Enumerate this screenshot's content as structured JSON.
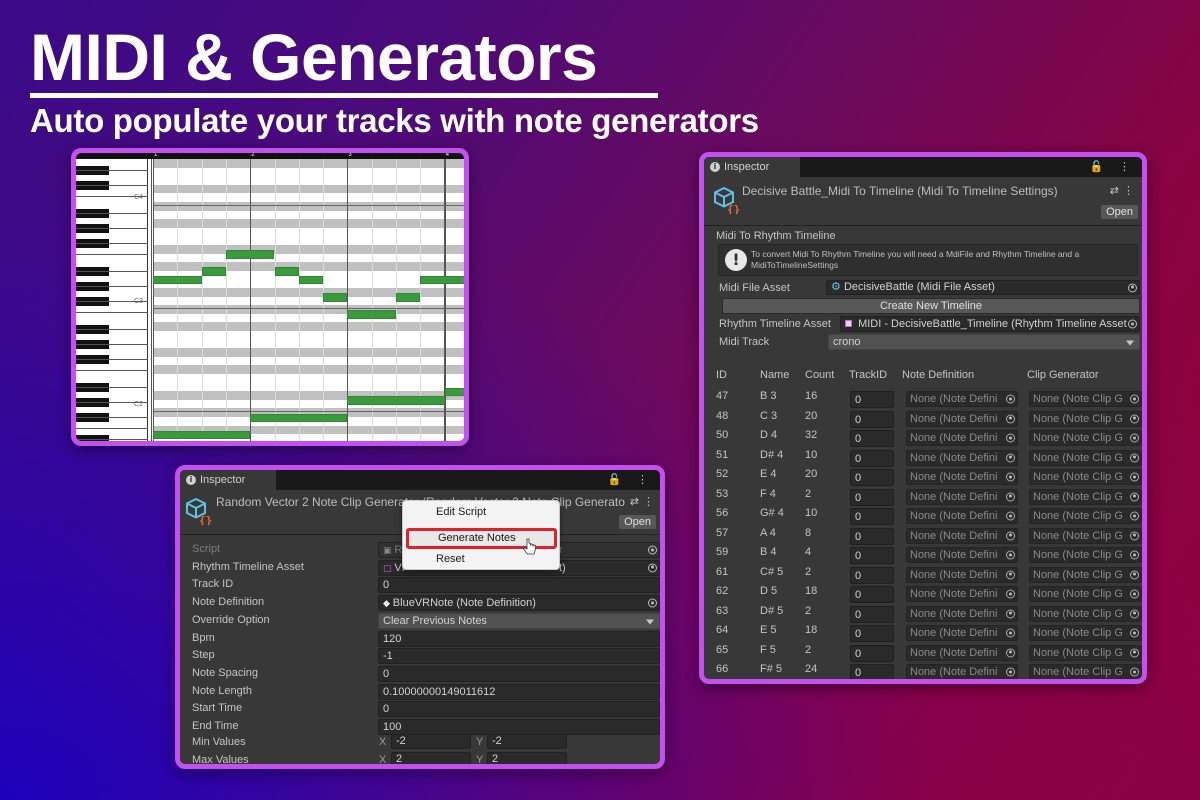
{
  "banner": {
    "title": "MIDI & Generators",
    "subtitle": "Auto populate your tracks with note generators"
  },
  "colors": {
    "panel_border": "#c550f0",
    "note_green": "#3a9a3c",
    "highlight_red": "#e0202a",
    "unity_bg": "#383838"
  },
  "piano_roll": {
    "bar_numbers": [
      "1",
      "2",
      "3",
      "4"
    ],
    "octave_labels": [
      "C4",
      "C3",
      "C2"
    ],
    "notes": [
      {
        "pitch_row": 14,
        "start_step": 0,
        "length_steps": 2
      },
      {
        "pitch_row": 13,
        "start_step": 2,
        "length_steps": 1
      },
      {
        "pitch_row": 11,
        "start_step": 3,
        "length_steps": 2
      },
      {
        "pitch_row": 13,
        "start_step": 5,
        "length_steps": 1
      },
      {
        "pitch_row": 14,
        "start_step": 6,
        "length_steps": 1
      },
      {
        "pitch_row": 16,
        "start_step": 7,
        "length_steps": 1
      },
      {
        "pitch_row": 18,
        "start_step": 8,
        "length_steps": 2
      },
      {
        "pitch_row": 16,
        "start_step": 10,
        "length_steps": 1
      },
      {
        "pitch_row": 14,
        "start_step": 11,
        "length_steps": 2
      },
      {
        "pitch_row": 27,
        "start_step": 12,
        "length_steps": 1
      },
      {
        "pitch_row": 28,
        "start_step": 8,
        "length_steps": 4
      },
      {
        "pitch_row": 30,
        "start_step": 4,
        "length_steps": 4
      },
      {
        "pitch_row": 32,
        "start_step": 0,
        "length_steps": 4
      }
    ]
  },
  "inspector_midi": {
    "tab_label": "Inspector",
    "tab_icons": "🔓 ⋮",
    "header_title": "Decisive Battle_Midi To Timeline (Midi To Timeline Settings)",
    "open_label": "Open",
    "section_label": "Midi To Rhythm Timeline",
    "help_text": "To convert Midi To Rhythm Timeline you will need a MdiFile and Rhythm Timeline and a MidiToTimelineSettings",
    "fields": {
      "midi_file_label": "Midi File Asset",
      "midi_file_value": "DecisiveBattle (Midi File Asset)",
      "create_button": "Create New Timeline",
      "rhythm_label": "Rhythm Timeline Asset",
      "rhythm_value": "MIDI - DecisiveBattle_Timeline (Rhythm Timeline Asset",
      "track_label": "Midi Track",
      "track_value": "crono"
    },
    "table": {
      "headers": [
        "ID",
        "Name",
        "Count",
        "TrackID",
        "Note Definition",
        "Clip Generator"
      ],
      "rows": [
        {
          "id": "47",
          "name": "B 3",
          "count": "16",
          "track_id": "0",
          "note_def": "None (Note Defini",
          "clip_gen": "None (Note Clip G"
        },
        {
          "id": "48",
          "name": "C 3",
          "count": "20",
          "track_id": "0",
          "note_def": "None (Note Defini",
          "clip_gen": "None (Note Clip G"
        },
        {
          "id": "50",
          "name": "D 4",
          "count": "32",
          "track_id": "0",
          "note_def": "None (Note Defini",
          "clip_gen": "None (Note Clip G"
        },
        {
          "id": "51",
          "name": "D# 4",
          "count": "10",
          "track_id": "0",
          "note_def": "None (Note Defini",
          "clip_gen": "None (Note Clip G"
        },
        {
          "id": "52",
          "name": "E 4",
          "count": "20",
          "track_id": "0",
          "note_def": "None (Note Defini",
          "clip_gen": "None (Note Clip G"
        },
        {
          "id": "53",
          "name": "F 4",
          "count": "2",
          "track_id": "0",
          "note_def": "None (Note Defini",
          "clip_gen": "None (Note Clip G"
        },
        {
          "id": "56",
          "name": "G# 4",
          "count": "10",
          "track_id": "0",
          "note_def": "None (Note Defini",
          "clip_gen": "None (Note Clip G"
        },
        {
          "id": "57",
          "name": "A 4",
          "count": "8",
          "track_id": "0",
          "note_def": "None (Note Defini",
          "clip_gen": "None (Note Clip G"
        },
        {
          "id": "59",
          "name": "B 4",
          "count": "4",
          "track_id": "0",
          "note_def": "None (Note Defini",
          "clip_gen": "None (Note Clip G"
        },
        {
          "id": "61",
          "name": "C# 5",
          "count": "2",
          "track_id": "0",
          "note_def": "None (Note Defini",
          "clip_gen": "None (Note Clip G"
        },
        {
          "id": "62",
          "name": "D 5",
          "count": "18",
          "track_id": "0",
          "note_def": "None (Note Defini",
          "clip_gen": "None (Note Clip G"
        },
        {
          "id": "63",
          "name": "D# 5",
          "count": "2",
          "track_id": "0",
          "note_def": "None (Note Defini",
          "clip_gen": "None (Note Clip G"
        },
        {
          "id": "64",
          "name": "E 5",
          "count": "18",
          "track_id": "0",
          "note_def": "None (Note Defini",
          "clip_gen": "None (Note Clip G"
        },
        {
          "id": "65",
          "name": "F 5",
          "count": "2",
          "track_id": "0",
          "note_def": "None (Note Defini",
          "clip_gen": "None (Note Clip G"
        },
        {
          "id": "66",
          "name": "F# 5",
          "count": "24",
          "track_id": "0",
          "note_def": "None (Note Defini",
          "clip_gen": "None (Note Clip G"
        }
      ]
    }
  },
  "inspector_gen": {
    "tab_label": "Inspector",
    "tab_icons": "🔓 ⋮",
    "header_title": "Random Vector 2 Note Clip Generator (Random Vector 2 Note Clip Generato",
    "open_label": "Open",
    "fields": [
      {
        "label": "Script",
        "value": "Ra",
        "value_tail": "r",
        "type": "object",
        "disabled": true
      },
      {
        "label": "Rhythm Timeline Asset",
        "value": "VF",
        "value_tail": "t)",
        "type": "object"
      },
      {
        "label": "Track ID",
        "value": "0",
        "type": "text"
      },
      {
        "label": "Note Definition",
        "value": "BlueVRNote (Note Definition)",
        "type": "object"
      },
      {
        "label": "Override Option",
        "value": "Clear Previous Notes",
        "type": "dropdown"
      },
      {
        "label": "Bpm",
        "value": "120",
        "type": "text"
      },
      {
        "label": "Step",
        "value": "-1",
        "type": "text"
      },
      {
        "label": "Note Spacing",
        "value": "0",
        "type": "text"
      },
      {
        "label": "Note Length",
        "value": "0.10000000149011612",
        "type": "text"
      },
      {
        "label": "Start Time",
        "value": "0",
        "type": "text"
      },
      {
        "label": "End Time",
        "value": "100",
        "type": "text"
      }
    ],
    "min_values": {
      "label": "Min Values",
      "x_label": "X",
      "x": "-2",
      "y_label": "Y",
      "y": "-2"
    },
    "max_values": {
      "label": "Max Values",
      "x_label": "X",
      "x": "2",
      "y_label": "Y",
      "y": "2"
    },
    "context_menu": {
      "items": [
        "Edit Script",
        "Generate Notes",
        "Reset"
      ],
      "highlighted": "Generate Notes"
    }
  }
}
